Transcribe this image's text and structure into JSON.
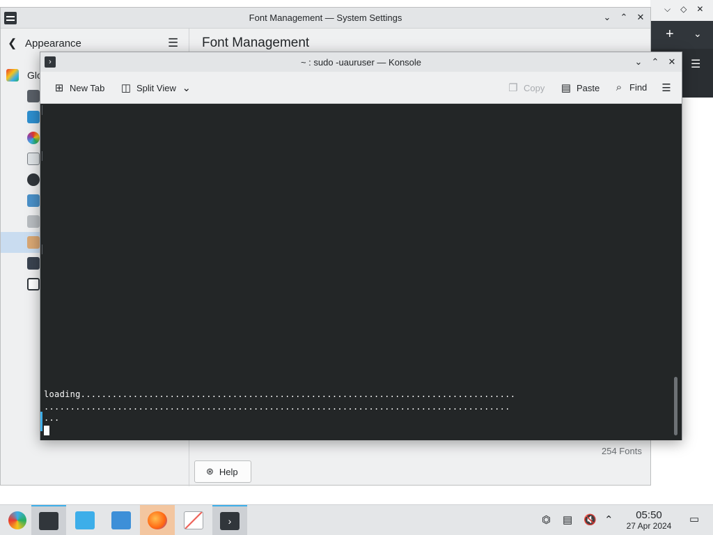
{
  "settings_window": {
    "title": "Font Management — System Settings",
    "breadcrumb": "Appearance",
    "page_title": "Font Management",
    "sidebar_first_label": "Glo",
    "font_count": "254 Fonts",
    "help_label": "Help"
  },
  "konsole_window": {
    "title": "~ : sudo -uauruser — Konsole",
    "toolbar": {
      "new_tab": "New Tab",
      "split_view": "Split View",
      "copy": "Copy",
      "paste": "Paste",
      "find": "Find"
    },
    "terminal_lines": [
      "loading...................................................................................",
      ".........................................................................................",
      "..."
    ]
  },
  "taskbar": {
    "time": "05:50",
    "date": "27 Apr 2024",
    "apps": [
      "launcher-icon",
      "system-settings-icon",
      "discover-icon",
      "file-manager-icon",
      "firefox-icon",
      "text-editor-icon",
      "konsole-icon"
    ]
  },
  "colors": {
    "accent": "#3daee9",
    "terminal_bg": "#232627",
    "window_bg": "#eff0f1"
  }
}
